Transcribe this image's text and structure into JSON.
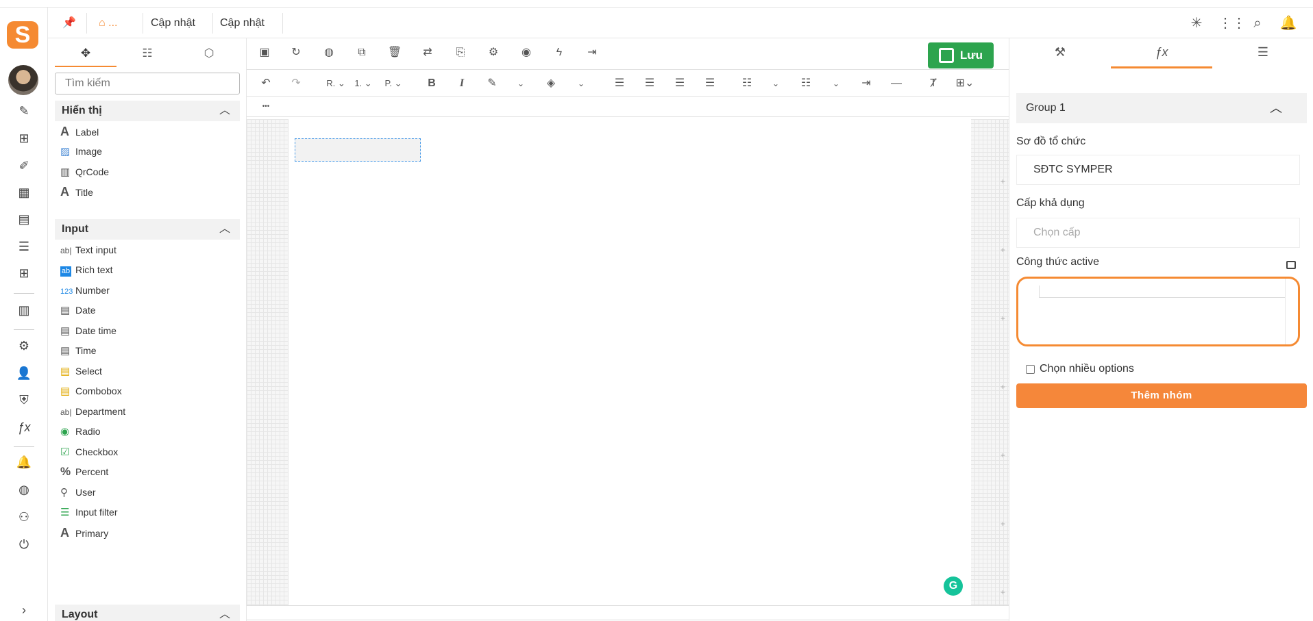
{
  "header": {
    "breadcrumb_home": "...",
    "tabs": [
      "Cập nhật",
      "Cập nhật"
    ]
  },
  "left_panel": {
    "search_placeholder": "Tìm kiếm",
    "groups": [
      {
        "title": "Hiển thị",
        "items": [
          {
            "label": "Label",
            "icon": "label-icon"
          },
          {
            "label": "Image",
            "icon": "image-icon"
          },
          {
            "label": "QrCode",
            "icon": "qrcode-icon"
          },
          {
            "label": "Title",
            "icon": "title-icon"
          }
        ]
      },
      {
        "title": "Input",
        "items": [
          {
            "label": "Text input",
            "icon": "text-input-icon"
          },
          {
            "label": "Rich text",
            "icon": "rich-text-icon"
          },
          {
            "label": "Number",
            "icon": "number-icon"
          },
          {
            "label": "Date",
            "icon": "date-icon"
          },
          {
            "label": "Date time",
            "icon": "datetime-icon"
          },
          {
            "label": "Time",
            "icon": "time-icon"
          },
          {
            "label": "Select",
            "icon": "select-icon"
          },
          {
            "label": "Combobox",
            "icon": "combobox-icon"
          },
          {
            "label": "Department",
            "icon": "department-icon"
          },
          {
            "label": "Radio",
            "icon": "radio-icon"
          },
          {
            "label": "Checkbox",
            "icon": "checkbox-icon"
          },
          {
            "label": "Percent",
            "icon": "percent-icon"
          },
          {
            "label": "User",
            "icon": "user-icon"
          },
          {
            "label": "Input filter",
            "icon": "input-filter-icon"
          },
          {
            "label": "Primary",
            "icon": "primary-icon"
          }
        ]
      },
      {
        "title": "Layout",
        "items": []
      }
    ]
  },
  "editor": {
    "save_label": "Lưu",
    "font_select": "R.",
    "size_select": "1.",
    "para_select": "P.",
    "more": "•••"
  },
  "right_panel": {
    "group_title": "Group 1",
    "org_chart_label": "Sơ đồ tổ chức",
    "org_chart_value": "SĐTC SYMPER",
    "level_label": "Cấp khả dụng",
    "level_placeholder": "Chọn cấp",
    "formula_label": "Công thức active",
    "multi_label": "Chọn nhiều options",
    "add_group_label": "Thêm nhóm"
  },
  "colors": {
    "accent": "#f58a32",
    "save_green": "#2da44e",
    "grammarly": "#15c39a"
  }
}
